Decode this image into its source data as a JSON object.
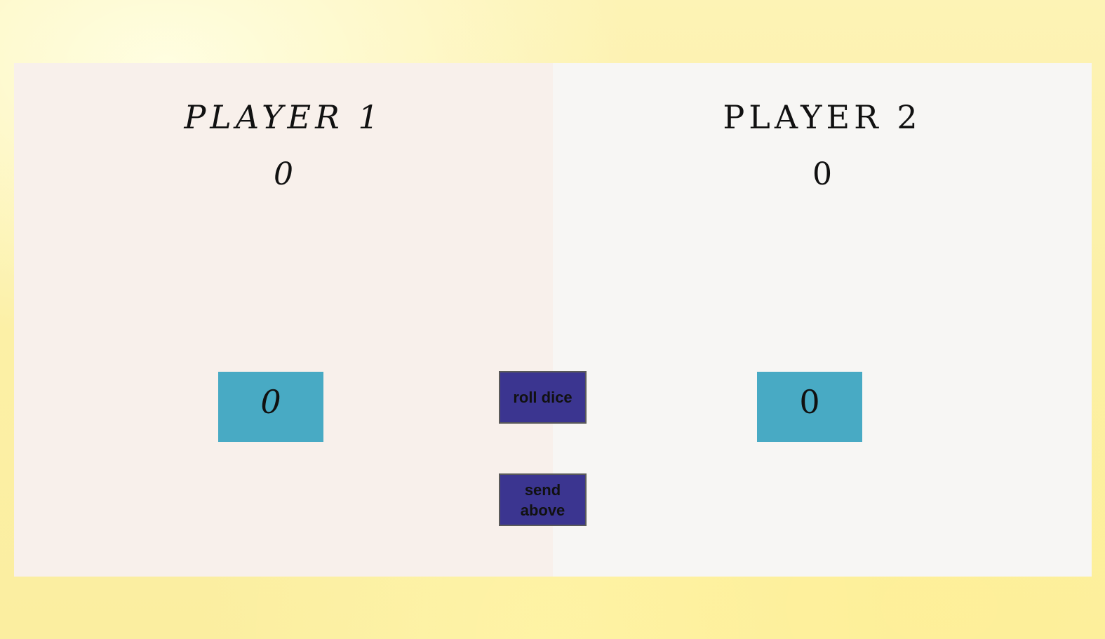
{
  "players": [
    {
      "name": "PLAYER 1",
      "total": "0",
      "current": "0",
      "active": true
    },
    {
      "name": "PLAYER 2",
      "total": "0",
      "current": "0",
      "active": false
    }
  ],
  "controls": {
    "roll_label": "roll dice",
    "hold_label": "send above"
  },
  "colors": {
    "current_box": "#48aac4",
    "button": "#3b3590",
    "player1_panel": "#f8f0eb",
    "player2_panel": "#f7f6f4"
  }
}
